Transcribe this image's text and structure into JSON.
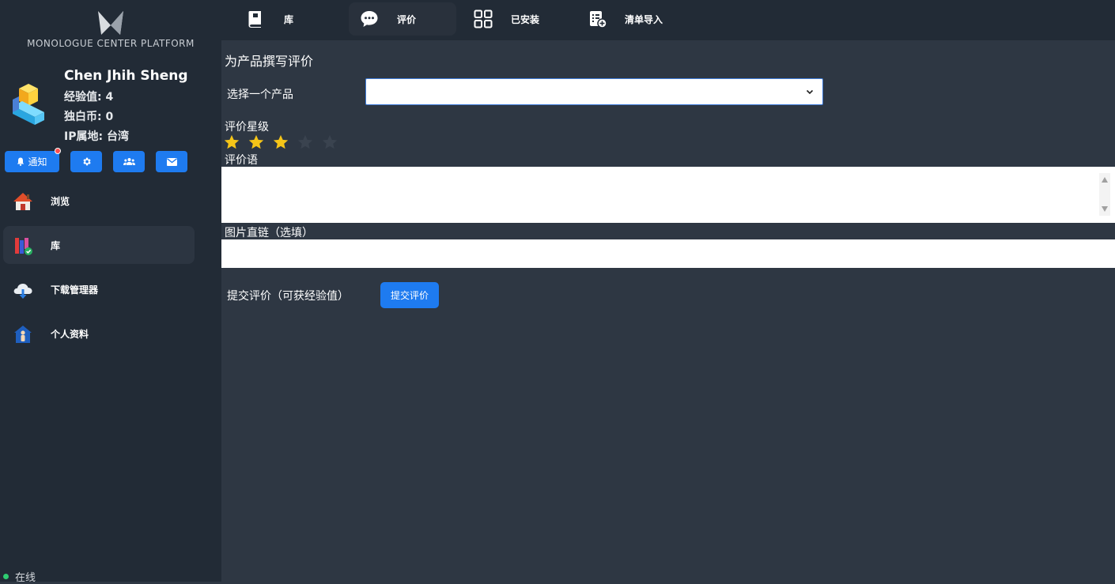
{
  "app": {
    "logo_text": "MONOLOGUE CENTER PLATFORM"
  },
  "user": {
    "name": "Chen Jhih Sheng",
    "exp": "经验值: 4",
    "coins": "独白币: 0",
    "location": "IP属地:  台湾"
  },
  "quick_buttons": {
    "notify_label": "通知",
    "settings_icon": "gear-icon",
    "friends_icon": "users-icon",
    "mail_icon": "mail-icon"
  },
  "sidebar": {
    "items": [
      {
        "label": "浏览",
        "icon": "home-icon"
      },
      {
        "label": "库",
        "icon": "library-icon"
      },
      {
        "label": "下载管理器",
        "icon": "cloud-download-icon"
      },
      {
        "label": "个人资料",
        "icon": "profile-icon"
      }
    ],
    "active_index": 1
  },
  "status": {
    "label": "在线",
    "color": "#2ecc71"
  },
  "tabs": [
    {
      "label": "库",
      "icon": "book-icon"
    },
    {
      "label": "评价",
      "icon": "chat-icon"
    },
    {
      "label": "已安装",
      "icon": "grid-icon"
    },
    {
      "label": "清单导入",
      "icon": "list-add-icon"
    }
  ],
  "active_tab": 1,
  "review": {
    "title": "为产品撰写评价",
    "product_label": "选择一个产品",
    "product_value": "",
    "rating_label": "评价星级",
    "rating": 3,
    "rating_max": 5,
    "comment_label": "评价语",
    "comment_value": "",
    "image_label": "图片直链（选填）",
    "image_value": "",
    "submit_hint": "提交评价（可获经验值）",
    "submit_label": "提交评价"
  },
  "colors": {
    "accent": "#1e7bf0",
    "sidebar_bg": "#222b36",
    "content_bg": "#2e3743",
    "star_on": "#f5c518",
    "star_off": "#3a434f"
  }
}
